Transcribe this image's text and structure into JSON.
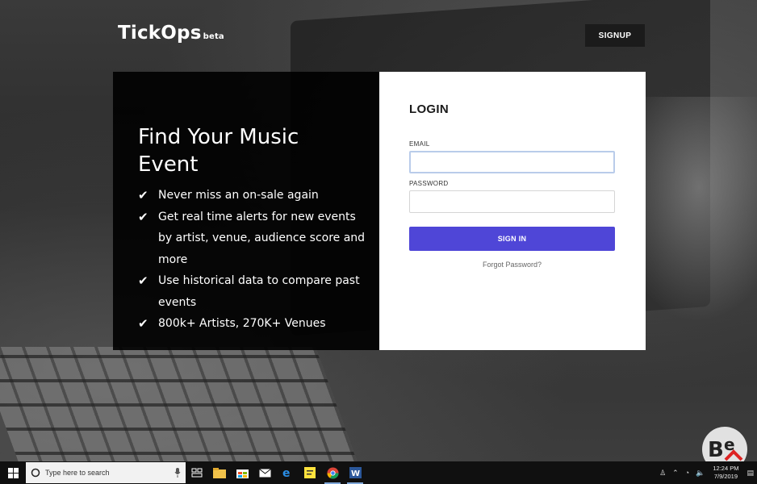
{
  "header": {
    "logo": "TickOps",
    "logo_tag": "beta",
    "signup_label": "SIGNUP"
  },
  "promo": {
    "heading": "Find Your Music Event",
    "features": [
      "Never miss an on-sale again",
      "Get real time alerts for new events by artist, venue, audience score and more",
      "Use historical data to compare past events",
      "800k+ Artists, 270K+ Venues"
    ]
  },
  "login": {
    "title": "LOGIN",
    "email_label": "EMAIL",
    "email_value": "",
    "password_label": "PASSWORD",
    "password_value": "",
    "signin_label": "SIGN IN",
    "forgot_label": "Forgot Password?"
  },
  "taskbar": {
    "search_placeholder": "Type here to search",
    "time": "12:24 PM",
    "date": "7/9/2019",
    "pinned_icons": [
      "task-view-icon",
      "file-explorer-icon",
      "store-icon",
      "mail-icon",
      "edge-icon",
      "sticky-notes-icon",
      "chrome-icon",
      "word-icon"
    ]
  },
  "colors": {
    "accent": "#4f46d7",
    "panel_dark": "#000000",
    "panel_light": "#ffffff"
  }
}
